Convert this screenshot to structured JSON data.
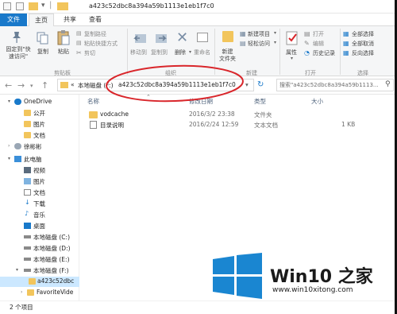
{
  "window": {
    "title": "a423c52dbc8a394a59b1113e1eb1f7c0"
  },
  "tabs": {
    "file": "文件",
    "home": "主页",
    "share": "共享",
    "view": "查看"
  },
  "ribbon": {
    "pin_quick_access": "固定到\"快速访问\"",
    "copy": "复制",
    "paste": "粘贴",
    "copy_path": "复制路径",
    "paste_shortcut": "粘贴快捷方式",
    "cut": "剪切",
    "move_to": "移动到",
    "copy_to": "复制到",
    "delete": "删除",
    "rename": "重命名",
    "new_folder": "新建\n文件夹",
    "new_item": "新建项目",
    "easy_access": "轻松访问",
    "properties": "属性",
    "open": "打开",
    "edit": "编辑",
    "history": "历史记录",
    "select_all": "全部选择",
    "select_none": "全部取消",
    "invert_selection": "反向选择",
    "group_clipboard": "剪贴板",
    "group_organize": "组织",
    "group_new": "新建",
    "group_open": "打开",
    "group_select": "选择"
  },
  "address": {
    "prefix": "«",
    "drive": "本地磁盘 (F:)",
    "folder": "a423c52dbc8a394a59b1113e1eb1f7c0",
    "search_placeholder": "搜索\"a423c52dbc8a394a59b1113..."
  },
  "nav": {
    "items": [
      {
        "label": "OneDrive"
      },
      {
        "label": "公开"
      },
      {
        "label": "图片"
      },
      {
        "label": "文档"
      },
      {
        "label": "徐彬彬"
      },
      {
        "label": "此电脑"
      },
      {
        "label": "视频"
      },
      {
        "label": "图片"
      },
      {
        "label": "文档"
      },
      {
        "label": "下载"
      },
      {
        "label": "音乐"
      },
      {
        "label": "桌面"
      },
      {
        "label": "本地磁盘 (C:)"
      },
      {
        "label": "本地磁盘 (D:)"
      },
      {
        "label": "本地磁盘 (E:)"
      },
      {
        "label": "本地磁盘 (F:)"
      },
      {
        "label": "a423c52dbc"
      },
      {
        "label": "FavoriteVide"
      }
    ]
  },
  "columns": {
    "name": "名称",
    "modified": "修改日期",
    "type": "类型",
    "size": "大小"
  },
  "files": [
    {
      "name": "vodcache",
      "date": "2016/3/2 23:38",
      "type": "文件夹",
      "size": ""
    },
    {
      "name": "目录说明",
      "date": "2016/2/24 12:59",
      "type": "文本文档",
      "size": "1 KB"
    }
  ],
  "status": {
    "count": "2 个项目"
  },
  "watermark": {
    "brand": "Win10 之家",
    "url": "www.win10xitong.com"
  },
  "colors": {
    "accent": "#1979ca",
    "selection": "#cce8ff",
    "annotation": "#d9262b",
    "folder": "#f2c55c"
  }
}
